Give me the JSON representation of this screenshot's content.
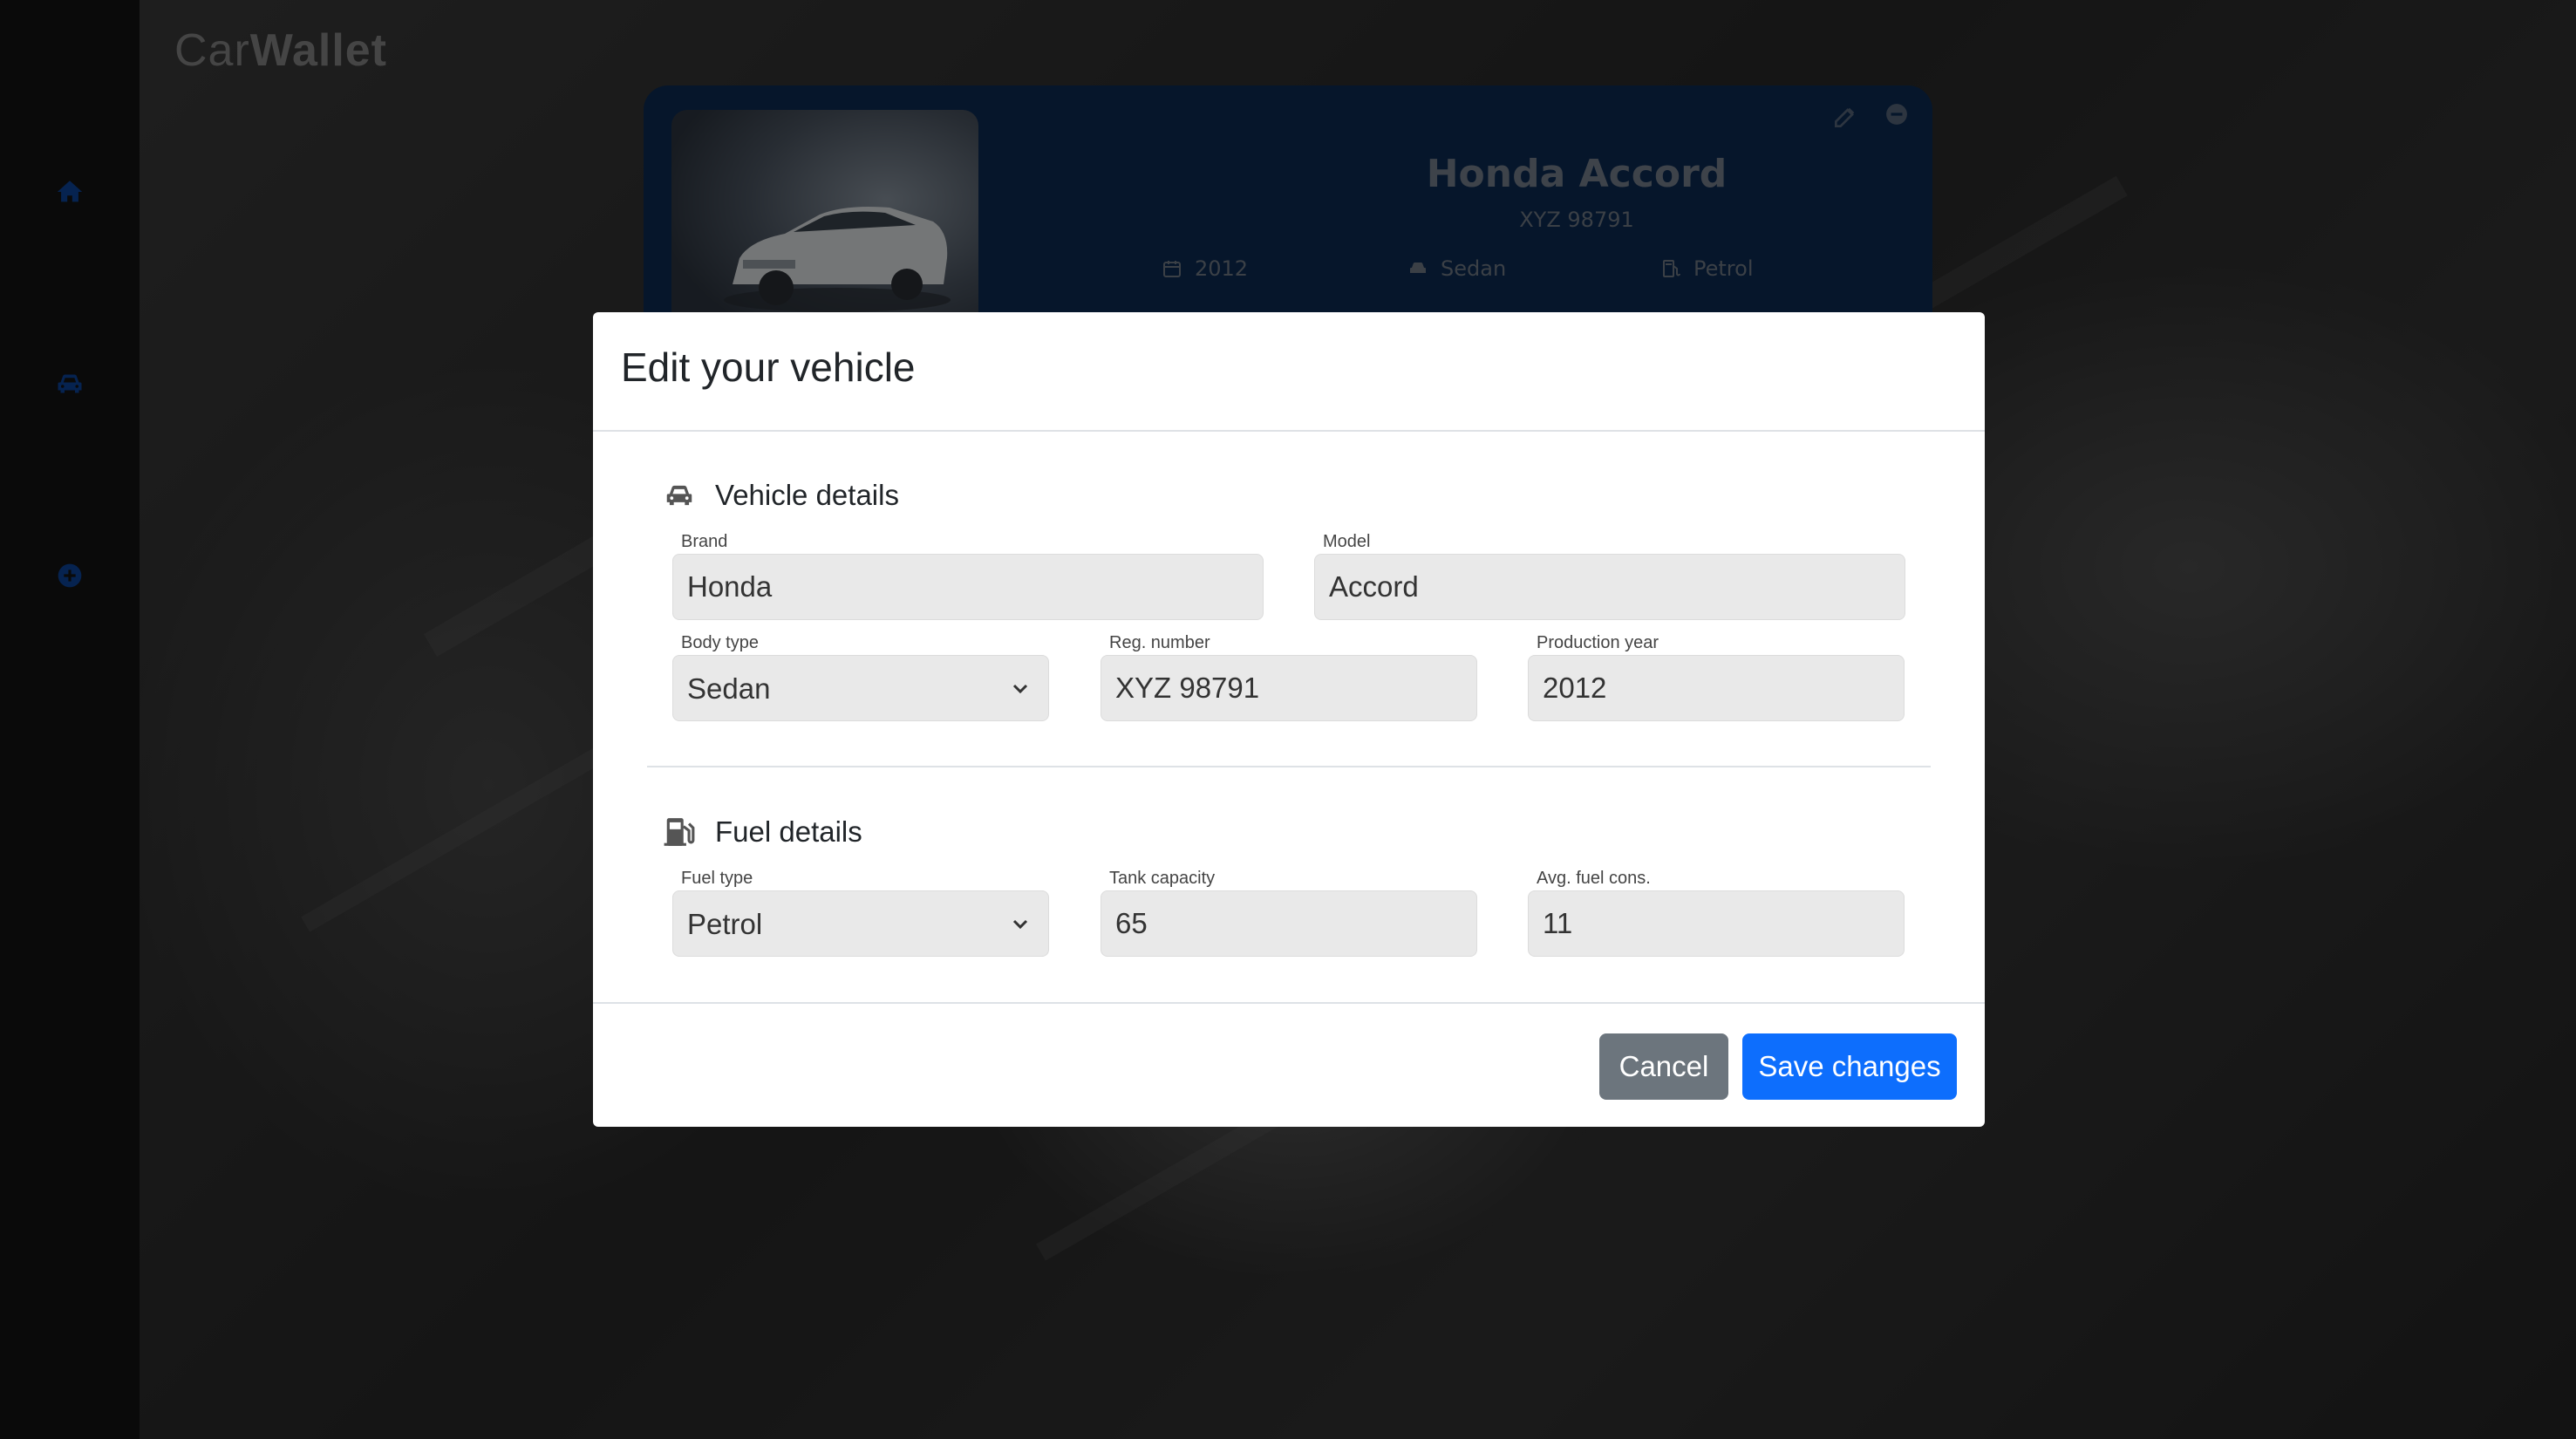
{
  "app": {
    "brand_light": "Car",
    "brand_bold": "Wallet"
  },
  "sidebar": {
    "items": [
      {
        "icon": "home-icon",
        "color": "#0d47a1"
      },
      {
        "icon": "car-icon",
        "color": "#0d47a1"
      },
      {
        "icon": "plus-circle-icon",
        "color": "#0d47a1"
      }
    ]
  },
  "vehicle_card": {
    "title": "Honda Accord",
    "plate": "XYZ 98791",
    "year": "2012",
    "body": "Sedan",
    "fuel": "Petrol",
    "background_color": "#0c2c57"
  },
  "modal": {
    "title": "Edit your vehicle",
    "vehicle_section": {
      "heading": "Vehicle details",
      "brand_label": "Brand",
      "brand_value": "Honda",
      "model_label": "Model",
      "model_value": "Accord",
      "body_label": "Body type",
      "body_value": "Sedan",
      "reg_label": "Reg. number",
      "reg_value": "XYZ 98791",
      "year_label": "Production year",
      "year_value": "2012"
    },
    "fuel_section": {
      "heading": "Fuel details",
      "fuel_type_label": "Fuel type",
      "fuel_type_value": "Petrol",
      "tank_label": "Tank capacity",
      "tank_value": "65",
      "cons_label": "Avg. fuel cons.",
      "cons_value": "11"
    },
    "cancel_label": "Cancel",
    "save_label": "Save changes",
    "colors": {
      "primary": "#0d6efd",
      "secondary": "#6c757d"
    }
  }
}
